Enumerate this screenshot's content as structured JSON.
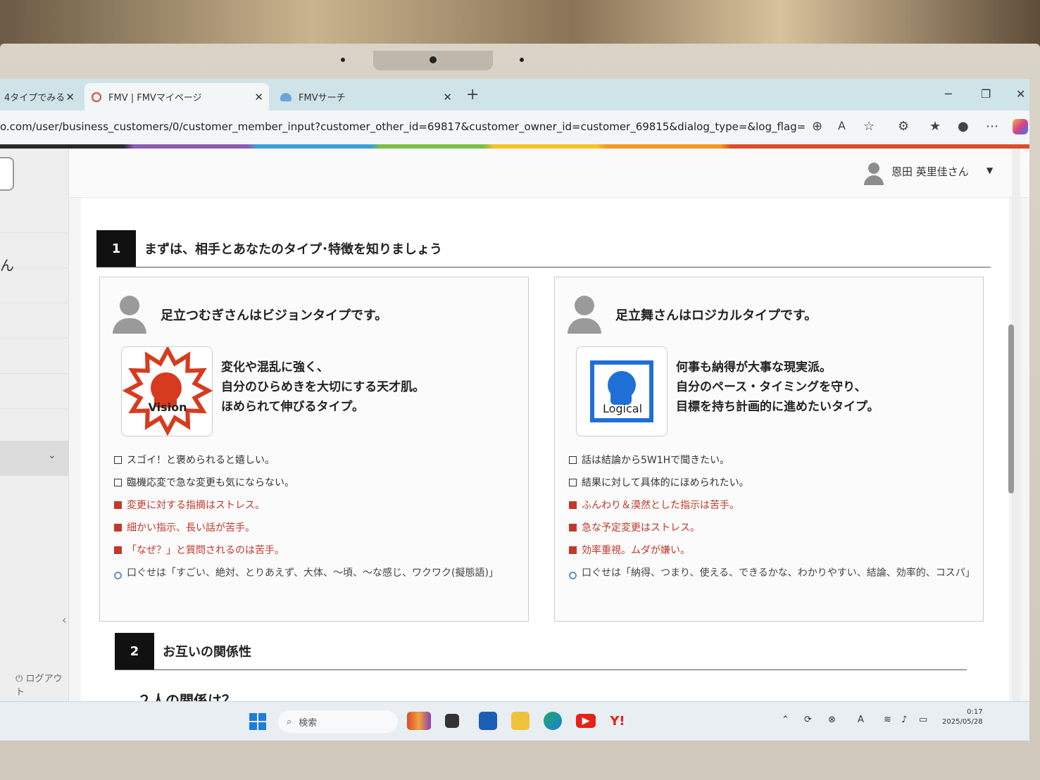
{
  "browser": {
    "tabs": [
      {
        "label": "4タイプでみる"
      },
      {
        "label": "FMV | FMVマイページ"
      },
      {
        "label": "FMVサーチ"
      }
    ],
    "new_tab_glyph": "+",
    "url": "o.com/user/business_customers/0/customer_member_input?customer_other_id=69817&customer_owner_id=customer_69815&dialog_type=&log_flag="
  },
  "header": {
    "user_name": "恩田 英里佳さん"
  },
  "sidebar": {
    "partial_text": "ん",
    "logout_label": "ログアウト"
  },
  "section1": {
    "number": "1",
    "title": "まずは、相手とあなたのタイプ･特徴を知りましょう"
  },
  "cards": [
    {
      "lead": "足立つむぎさんはビジョンタイプです。",
      "badge_label": "Vision",
      "description": [
        "変化や混乱に強く、",
        "自分のひらめきを大切にする天才肌。",
        "ほめられて伸びるタイプ。"
      ],
      "checks": [
        {
          "style": "plain",
          "text": "スゴイ！と褒められると嬉しい。"
        },
        {
          "style": "plain",
          "text": "臨機応変で急な変更も気にならない。"
        },
        {
          "style": "red",
          "text": "変更に対する指摘はストレス。"
        },
        {
          "style": "red",
          "text": "細かい指示、長い話が苦手。"
        },
        {
          "style": "red",
          "text": "「なぜ？」と質問されるのは苦手。"
        },
        {
          "style": "blue",
          "text": "口ぐせは「すごい、絶対、とりあえず、大体、〜頃、〜な感じ、ワクワク(擬態語)」"
        }
      ],
      "accent": "#d63b1f"
    },
    {
      "lead": "足立舞さんはロジカルタイプです。",
      "badge_label": "Logical",
      "description": [
        "何事も納得が大事な現実派。",
        "自分のペース・タイミングを守り、",
        "目標を持ち計画的に進めたいタイプ。"
      ],
      "checks": [
        {
          "style": "plain",
          "text": "話は結論から5W1Hで聞きたい。"
        },
        {
          "style": "plain",
          "text": "結果に対して具体的にほめられたい。"
        },
        {
          "style": "red",
          "text": "ふんわり＆漠然とした指示は苦手。"
        },
        {
          "style": "red",
          "text": "急な予定変更はストレス。"
        },
        {
          "style": "red",
          "text": "効率重視。ムダが嫌い。"
        },
        {
          "style": "blue",
          "text": "口ぐせは「納得、つまり、使える、できるかな、わかりやすい、結論、効率的、コスパ」"
        }
      ],
      "accent": "#1f6fd6"
    }
  ],
  "section2": {
    "number": "2",
    "title": "お互いの関係性",
    "subheading": "２人の関係は？"
  },
  "taskbar": {
    "search_placeholder": "検索",
    "time": "0:17",
    "date": "2025/05/28"
  }
}
